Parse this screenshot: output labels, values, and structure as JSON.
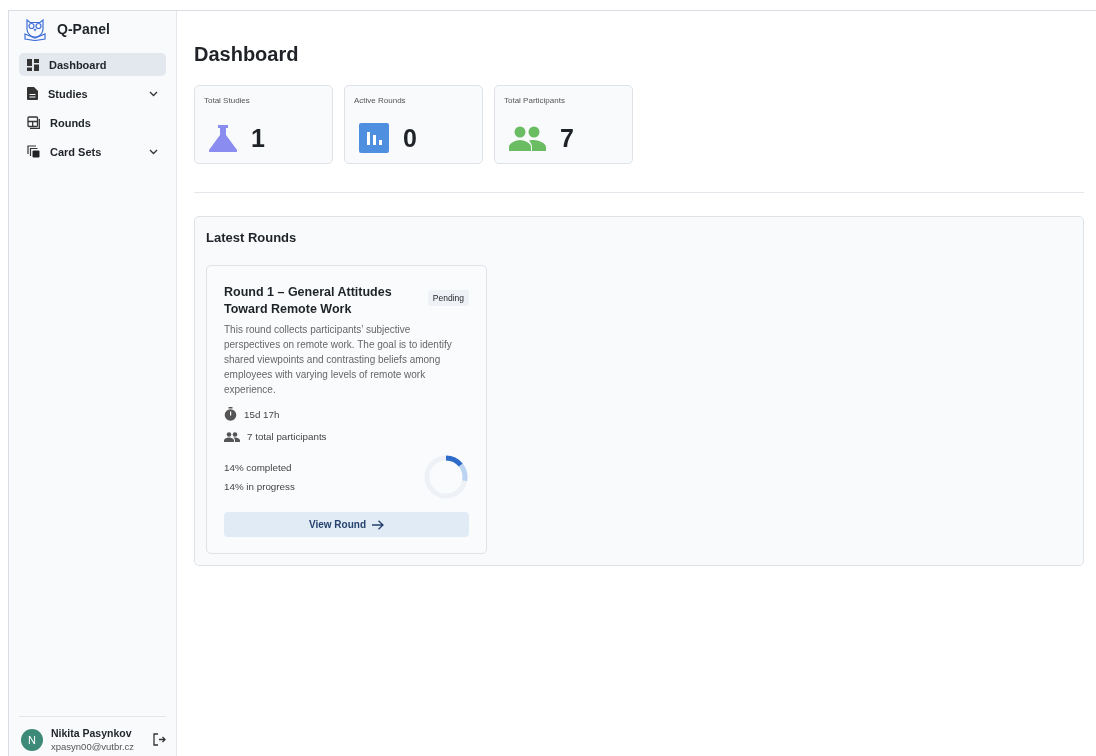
{
  "sidebar": {
    "app_name": "Q-Panel",
    "items": [
      {
        "label": "Dashboard",
        "selected": true,
        "expandable": false
      },
      {
        "label": "Studies",
        "selected": false,
        "expandable": true
      },
      {
        "label": "Rounds",
        "selected": false,
        "expandable": false
      },
      {
        "label": "Card Sets",
        "selected": false,
        "expandable": true
      }
    ],
    "user": {
      "initial": "N",
      "name": "Nikita Pasynkov",
      "email": "xpasyn00@vutbr.cz"
    }
  },
  "page_title": "Dashboard",
  "stats": [
    {
      "label": "Total Studies",
      "value": "1"
    },
    {
      "label": "Active Rounds",
      "value": "0"
    },
    {
      "label": "Total Participants",
      "value": "7"
    }
  ],
  "latest_rounds": {
    "title": "Latest Rounds",
    "rounds": [
      {
        "title": "Round 1 – General Attitudes Toward Remote Work",
        "status": "Pending",
        "description": "This round collects participants’ subjective perspectives on remote work. The goal is to identify shared viewpoints and contrasting beliefs among employees with varying levels of remote work experience.",
        "time_left": "15d 17h",
        "participants": "7 total participants",
        "completed_text": "14% completed",
        "in_progress_text": "14% in progress",
        "completed": {
          "level": 0.14
        },
        "in_progress": {
          "level": 0.14
        },
        "button": "View Round"
      }
    ]
  }
}
